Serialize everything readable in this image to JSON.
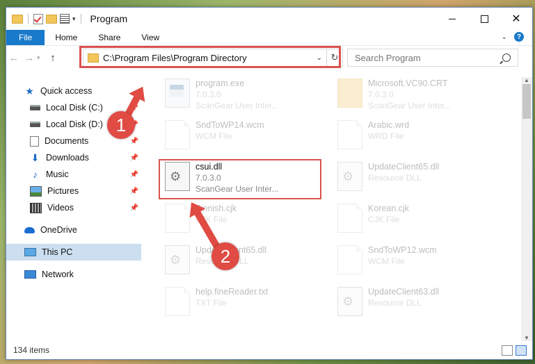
{
  "window": {
    "title": "Program"
  },
  "ribbon": {
    "tabs": [
      "File",
      "Home",
      "Share",
      "View"
    ]
  },
  "address": {
    "path": "C:\\Program Files\\Program Directory"
  },
  "search": {
    "placeholder": "Search Program"
  },
  "sidebar": {
    "items": [
      {
        "label": "Quick access",
        "icon": "star-icon"
      },
      {
        "label": "Local Disk (C:)",
        "icon": "disk-icon",
        "pinned": true
      },
      {
        "label": "Local Disk (D:)",
        "icon": "disk-icon",
        "pinned": true
      },
      {
        "label": "Documents",
        "icon": "documents-icon",
        "pinned": true
      },
      {
        "label": "Downloads",
        "icon": "downloads-icon",
        "pinned": true
      },
      {
        "label": "Music",
        "icon": "music-icon",
        "pinned": true
      },
      {
        "label": "Pictures",
        "icon": "pictures-icon",
        "pinned": true
      },
      {
        "label": "Videos",
        "icon": "videos-icon",
        "pinned": true
      },
      {
        "label": "OneDrive",
        "icon": "onedrive-icon"
      },
      {
        "label": "This PC",
        "icon": "pc-icon",
        "selected": true
      },
      {
        "label": "Network",
        "icon": "network-icon"
      }
    ]
  },
  "files": [
    {
      "name": "program.exe",
      "line1": "7.0.3.0",
      "line2": "ScanGear User Inter...",
      "icon": "exe"
    },
    {
      "name": "Microsoft.VC90.CRT",
      "line1": "7.0.3.0",
      "line2": "ScanGear User Inter...",
      "icon": "folder"
    },
    {
      "name": "SndToWP14.wcm",
      "line1": "WCM File",
      "line2": "",
      "icon": "doc"
    },
    {
      "name": "Arabic.wrd",
      "line1": "WRD File",
      "line2": "",
      "icon": "doc"
    },
    {
      "name": "csui.dll",
      "line1": "7.0.3.0",
      "line2": "ScanGear User Inter...",
      "icon": "gear",
      "highlight": true
    },
    {
      "name": "UpdateClient65.dll",
      "line1": "Resource DLL",
      "line2": "",
      "icon": "gear"
    },
    {
      "name": "Finnish.cjk",
      "line1": "CJK File",
      "line2": "",
      "icon": "doc"
    },
    {
      "name": "Korean.cjk",
      "line1": "CJK File",
      "line2": "",
      "icon": "doc"
    },
    {
      "name": "UpdateClient65.dll",
      "line1": "Resource DLL",
      "line2": "",
      "icon": "gear"
    },
    {
      "name": "SndToWP12.wcm",
      "line1": "WCM File",
      "line2": "",
      "icon": "doc"
    },
    {
      "name": "help.fineReader.txt",
      "line1": "TXT File",
      "line2": "",
      "icon": "doc"
    },
    {
      "name": "UpdateClient63.dll",
      "line1": "Resource DLL",
      "line2": "",
      "icon": "gear"
    }
  ],
  "status": {
    "count": "134 items"
  },
  "annotations": {
    "step1": "1",
    "step2": "2",
    "color": "#e04b43"
  }
}
